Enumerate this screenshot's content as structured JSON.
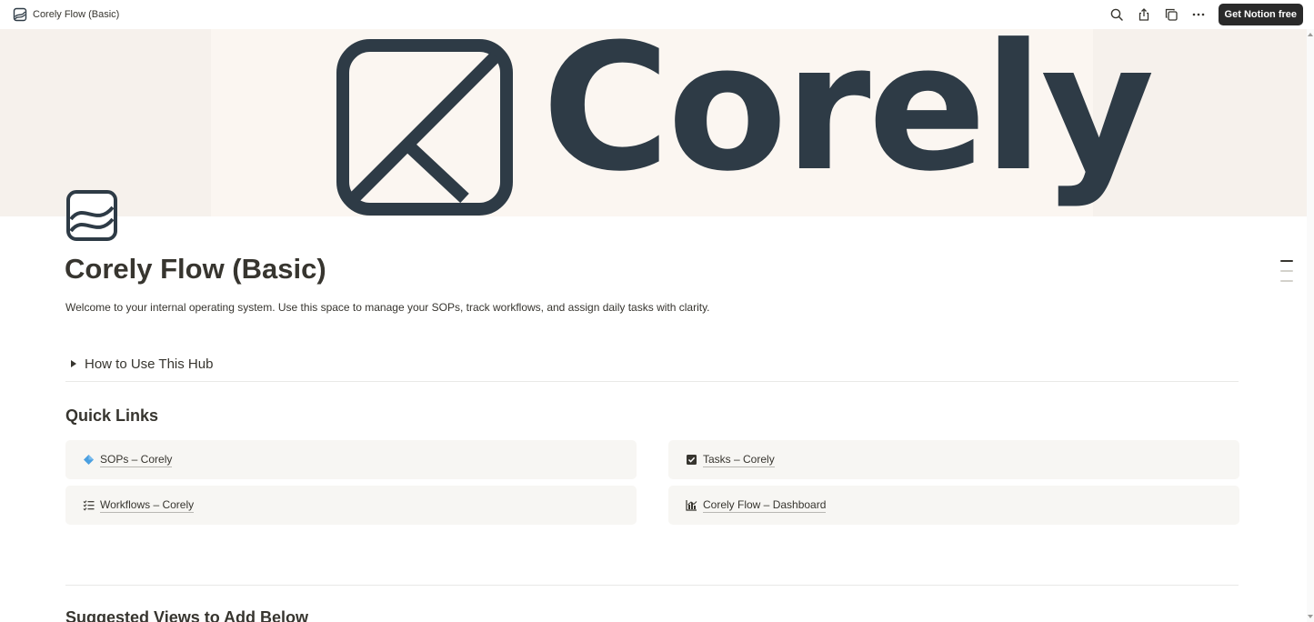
{
  "topbar": {
    "title": "Corely Flow (Basic)",
    "cta_label": "Get Notion free",
    "icons": [
      "search-icon",
      "share-icon",
      "duplicate-icon",
      "more-icon"
    ]
  },
  "cover": {
    "brand_word": "Corely",
    "background_color": "#f6f1ec",
    "brand_color": "#2e3b46"
  },
  "page": {
    "title": "Corely Flow (Basic)",
    "intro": "Welcome to your internal operating system. Use this space to manage your SOPs, track workflows, and assign daily tasks with clarity.",
    "toggle_label": "How to Use This Hub",
    "quick_links_heading": "Quick Links",
    "suggested_heading": "Suggested Views to Add Below"
  },
  "quick_links": [
    {
      "label": "SOPs – Corely",
      "icon": "diamond-icon",
      "icon_color": "#4a9fe0"
    },
    {
      "label": "Tasks – Corely",
      "icon": "checkbox-icon",
      "icon_color": "#37352f"
    },
    {
      "label": "Workflows – Corely",
      "icon": "checklist-icon",
      "icon_color": "#37352f"
    },
    {
      "label": "Corely Flow – Dashboard",
      "icon": "chart-icon",
      "icon_color": "#37352f"
    }
  ]
}
